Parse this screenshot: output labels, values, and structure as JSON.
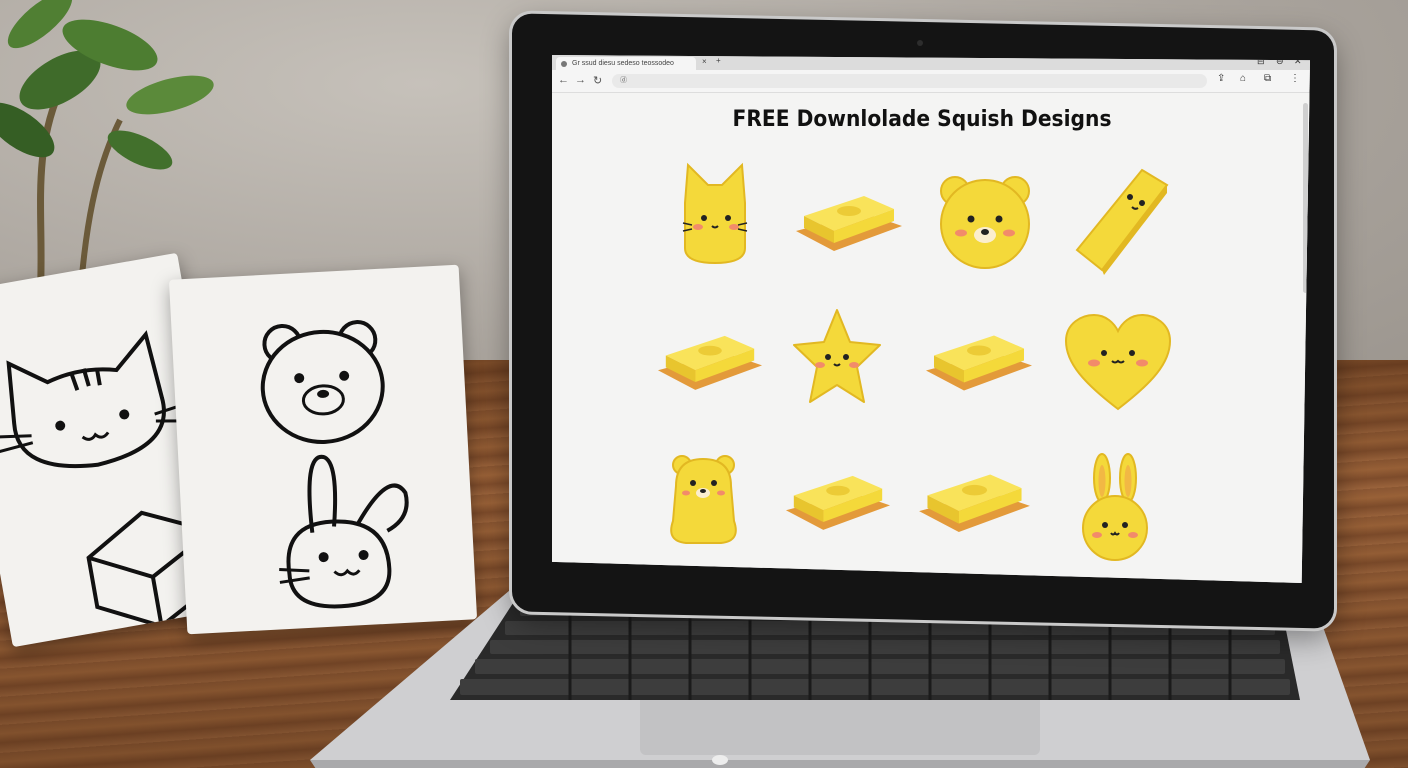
{
  "browser": {
    "tab_title": "Gr ssud diesu sedeso teossodeo",
    "tab_close": "×",
    "new_tab": "+",
    "address": "ⓓ",
    "window_controls": [
      "⊟",
      "⊖",
      "✕"
    ]
  },
  "page": {
    "title": "FREE Downlolade Squish Designs",
    "designs": [
      {
        "name": "cat",
        "icon": "cat-squishy-icon"
      },
      {
        "name": "butter",
        "icon": "butter-squishy-icon"
      },
      {
        "name": "bear",
        "icon": "bear-squishy-icon"
      },
      {
        "name": "butter-stick",
        "icon": "butter-stick-squishy-icon"
      },
      {
        "name": "butter",
        "icon": "butter-squishy-icon"
      },
      {
        "name": "star",
        "icon": "star-squishy-icon"
      },
      {
        "name": "butter",
        "icon": "butter-squishy-icon"
      },
      {
        "name": "heart",
        "icon": "heart-squishy-icon"
      },
      {
        "name": "bear-standing",
        "icon": "bear-standing-squishy-icon"
      },
      {
        "name": "butter",
        "icon": "butter-squishy-icon"
      },
      {
        "name": "butter",
        "icon": "butter-squishy-icon"
      },
      {
        "name": "bunny",
        "icon": "bunny-squishy-icon"
      }
    ]
  },
  "colors": {
    "squish_yellow": "#f4d93a",
    "squish_shade": "#e2b822",
    "butter_plate": "#e39a3a",
    "screen_bg": "#f4f4f3"
  }
}
